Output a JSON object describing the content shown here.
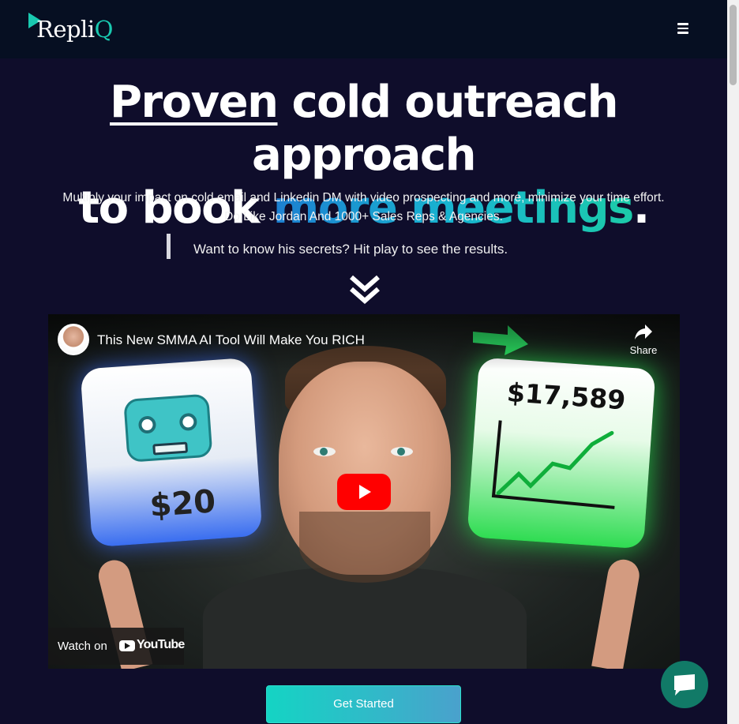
{
  "nav": {
    "logo_text": "Repli",
    "logo_accent": "Q",
    "menu_icon": "hamburger-menu-icon"
  },
  "hero": {
    "headline_word1": "Proven",
    "headline_part2": " cold outreach approach",
    "headline_part3": "to book ",
    "headline_highlight": "more meetings",
    "headline_end": ".",
    "subtitle_line1": "Multiply your impact on cold email and Linkedin DM with video prospecting and more, minimize your time effort.",
    "subtitle_line2": "Do Like Jordan And 1000+ Sales Reps & Agencies.",
    "quote": "Want to know his secrets? Hit play to see the results.",
    "arrow_icon": "double-chevron-down-icon"
  },
  "video": {
    "title": "This New SMMA AI Tool Will Make You RICH",
    "share_label": "Share",
    "watch_on_label": "Watch on",
    "youtube_label": "YouTube",
    "thumbnail_left_price": "$20",
    "thumbnail_right_price": "$17,589"
  },
  "cta": {
    "label": "Get Started"
  },
  "chat": {
    "icon": "chat-bubble-icon"
  },
  "colors": {
    "background": "#0f0d2b",
    "navbar": "#060f22",
    "accent_teal": "#19c9b0",
    "gradient_start": "#1d7fd1",
    "gradient_end": "#1ccba9",
    "chat_green": "#117a67",
    "youtube_red": "#ff0000"
  }
}
